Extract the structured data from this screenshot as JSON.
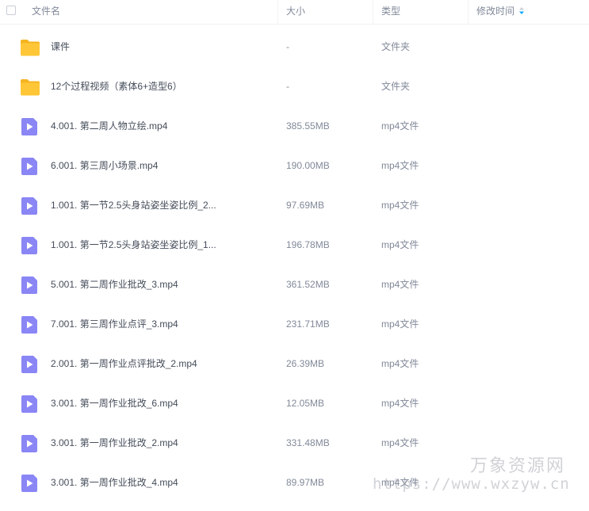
{
  "header": {
    "name": "文件名",
    "size": "大小",
    "type": "类型",
    "modified": "修改时间",
    "sort_icon": "sort-arrow-icon",
    "sort_color": "#06a7ff"
  },
  "colors": {
    "folder": "#ffc737",
    "folder_tab": "#f5b521",
    "video": "#8a86f5",
    "text": "#454d5a",
    "muted": "#818999"
  },
  "rows": [
    {
      "icon": "folder-icon",
      "name": "课件",
      "size": "-",
      "type": "文件夹"
    },
    {
      "icon": "folder-icon",
      "name": "12个过程视频（素体6+造型6）",
      "size": "-",
      "type": "文件夹"
    },
    {
      "icon": "video-file-icon",
      "name": "4.001. 第二周人物立绘.mp4",
      "size": "385.55MB",
      "type": "mp4文件"
    },
    {
      "icon": "video-file-icon",
      "name": "6.001. 第三周小场景.mp4",
      "size": "190.00MB",
      "type": "mp4文件"
    },
    {
      "icon": "video-file-icon",
      "name": "1.001. 第一节2.5头身站姿坐姿比例_2...",
      "size": "97.69MB",
      "type": "mp4文件"
    },
    {
      "icon": "video-file-icon",
      "name": "1.001. 第一节2.5头身站姿坐姿比例_1...",
      "size": "196.78MB",
      "type": "mp4文件"
    },
    {
      "icon": "video-file-icon",
      "name": "5.001. 第二周作业批改_3.mp4",
      "size": "361.52MB",
      "type": "mp4文件"
    },
    {
      "icon": "video-file-icon",
      "name": "7.001. 第三周作业点评_3.mp4",
      "size": "231.71MB",
      "type": "mp4文件"
    },
    {
      "icon": "video-file-icon",
      "name": "2.001. 第一周作业点评批改_2.mp4",
      "size": "26.39MB",
      "type": "mp4文件"
    },
    {
      "icon": "video-file-icon",
      "name": "3.001. 第一周作业批改_6.mp4",
      "size": "12.05MB",
      "type": "mp4文件"
    },
    {
      "icon": "video-file-icon",
      "name": "3.001. 第一周作业批改_2.mp4",
      "size": "331.48MB",
      "type": "mp4文件"
    },
    {
      "icon": "video-file-icon",
      "name": "3.001. 第一周作业批改_4.mp4",
      "size": "89.97MB",
      "type": "mp4文件"
    }
  ],
  "watermark": {
    "title": "万象资源网",
    "url": "https://www.wxzyw.cn"
  }
}
